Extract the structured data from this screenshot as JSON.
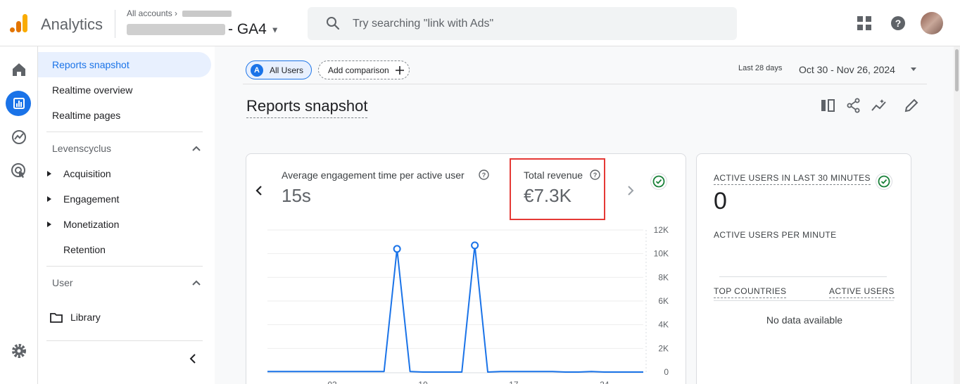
{
  "header": {
    "app_name": "Analytics",
    "breadcrumb_root": "All accounts",
    "property_suffix": "- GA4",
    "search_placeholder": "Try searching \"link with Ads\""
  },
  "nav": {
    "items": [
      "Reports snapshot",
      "Realtime overview",
      "Realtime pages"
    ],
    "section_lifecycle": "Levenscyclus",
    "lifecycle_items": [
      "Acquisition",
      "Engagement",
      "Monetization",
      "Retention"
    ],
    "section_user": "User",
    "library": "Library"
  },
  "main": {
    "chip_all_users": "All Users",
    "chip_avatar_letter": "A",
    "add_comparison": "Add comparison",
    "date_tag": "Last 28 days",
    "date_range": "Oct 30 - Nov 26, 2024",
    "title": "Reports snapshot"
  },
  "metrics": {
    "engagement_label": "Average engagement time per active user",
    "engagement_value": "15s",
    "revenue_label": "Total revenue",
    "revenue_value": "€7.3K"
  },
  "realtime": {
    "active_users_label": "ACTIVE USERS IN LAST 30 MINUTES",
    "active_users_value": "0",
    "per_minute_label": "ACTIVE USERS PER MINUTE",
    "col_countries": "TOP COUNTRIES",
    "col_active": "ACTIVE USERS",
    "no_data": "No data available"
  },
  "colors": {
    "accent": "#1a73e8",
    "highlight": "#e53935",
    "success": "#188038"
  },
  "chart_data": {
    "type": "line",
    "series": [
      {
        "values": [
          50,
          50,
          50,
          50,
          50,
          50,
          50,
          50,
          50,
          50,
          10400,
          50,
          0,
          0,
          0,
          0,
          10700,
          0,
          50,
          50,
          50,
          50,
          50,
          0,
          0,
          50,
          0,
          0,
          0,
          0
        ]
      }
    ],
    "x_labels": [
      "03",
      "10",
      "17",
      "24"
    ],
    "x_label_positions": [
      5,
      12,
      19,
      26
    ],
    "y_ticks": [
      "0",
      "2K",
      "4K",
      "6K",
      "8K",
      "10K",
      "12K"
    ],
    "y_tick_values": [
      0,
      2000,
      4000,
      6000,
      8000,
      10000,
      12000
    ],
    "ylim": [
      0,
      12000
    ],
    "markers": [
      10,
      16
    ]
  }
}
